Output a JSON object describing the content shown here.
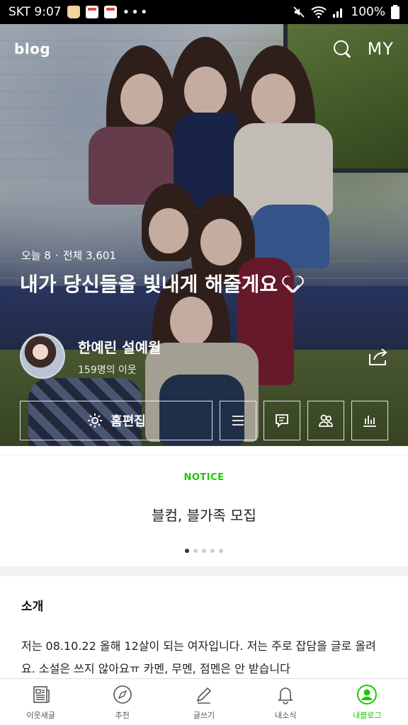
{
  "status_bar": {
    "carrier_time": "SKT 9:07",
    "dots": "•••",
    "battery": "100%"
  },
  "header": {
    "logo": "blog",
    "my_label": "MY"
  },
  "stats": {
    "today_label": "오늘 8",
    "separator": "·",
    "total_label": "전체 3,601"
  },
  "blog": {
    "title": "내가 당신들을 빛내게 해줄게요"
  },
  "owner": {
    "name": "한예린 설예월",
    "neighbors": "159명의 이웃"
  },
  "actions": {
    "home_edit": "홈편집"
  },
  "notice": {
    "label": "NOTICE",
    "title": "블컴, 블가족 모집",
    "page_count": 5,
    "active_page": 1
  },
  "intro": {
    "title": "소개",
    "body": "저는 08.10.22 올해 12살이 되는 여자입니다. 저는 주로 잡담을 글로 올려요. 소설은 쓰지 않아요ㅠ 카멘, 무멘, 점멘은 안 받습니다"
  },
  "bottom_nav": [
    {
      "label": "이웃새글",
      "icon": "newspaper-icon"
    },
    {
      "label": "추천",
      "icon": "compass-icon"
    },
    {
      "label": "글쓰기",
      "icon": "pencil-icon"
    },
    {
      "label": "내소식",
      "icon": "bell-icon"
    },
    {
      "label": "내블로그",
      "icon": "profile-icon"
    }
  ],
  "colors": {
    "accent": "#1ec800",
    "status_bar_bg": "#000000"
  }
}
